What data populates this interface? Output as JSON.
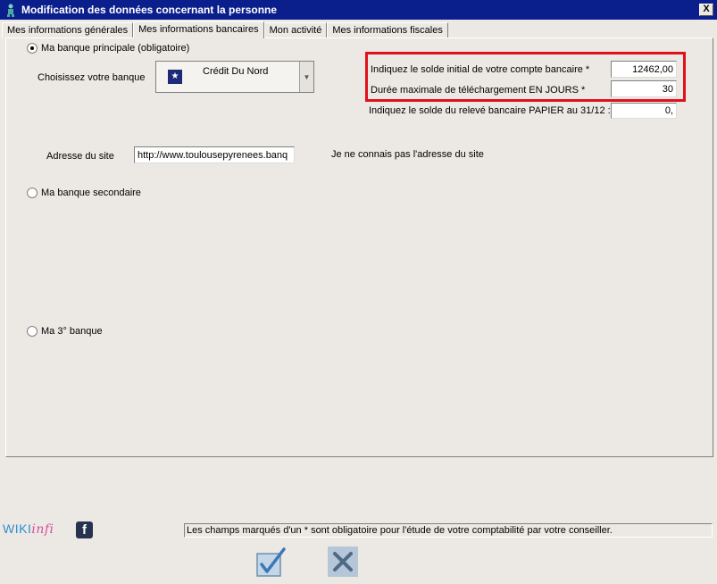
{
  "window": {
    "title": "Modification des données concernant la personne",
    "close_label": "X"
  },
  "tabs": [
    {
      "label": "Mes informations générales",
      "active": false
    },
    {
      "label": "Mes informations bancaires",
      "active": true
    },
    {
      "label": "Mon activité",
      "active": false
    },
    {
      "label": "Mes informations fiscales",
      "active": false
    }
  ],
  "bank_principal": {
    "radio_label": "Ma banque principale (obligatoire)",
    "choose_label": "Choisissez votre banque",
    "selected_bank": "Crédit Du Nord",
    "site_label": "Adresse du site",
    "site_value": "http://www.toulousepyrenees.banq",
    "unknown_site_label": "Je ne connais pas l'adresse du site"
  },
  "fields": {
    "initial_balance_label": "Indiquez le solde initial de votre compte bancaire *",
    "initial_balance_value": "12462,00",
    "max_download_label": "Durée maximale de téléchargement EN JOURS *",
    "max_download_value": "30",
    "paper_balance_label": "Indiquez le solde du relevé bancaire PAPIER au 31/12 :",
    "paper_balance_value": "0,"
  },
  "bank_secondary": {
    "radio_label": "Ma banque secondaire"
  },
  "bank_third": {
    "radio_label": "Ma 3° banque"
  },
  "footer": {
    "wiki_text": "WIKI",
    "infi_text": "infi",
    "fb_glyph": "f",
    "notice": "Les champs marqués d'un * sont obligatoire pour l'étude de votre comptabilité par votre conseiller."
  },
  "colors": {
    "titlebar": "#0a1e8c",
    "highlight": "#e0101c"
  }
}
